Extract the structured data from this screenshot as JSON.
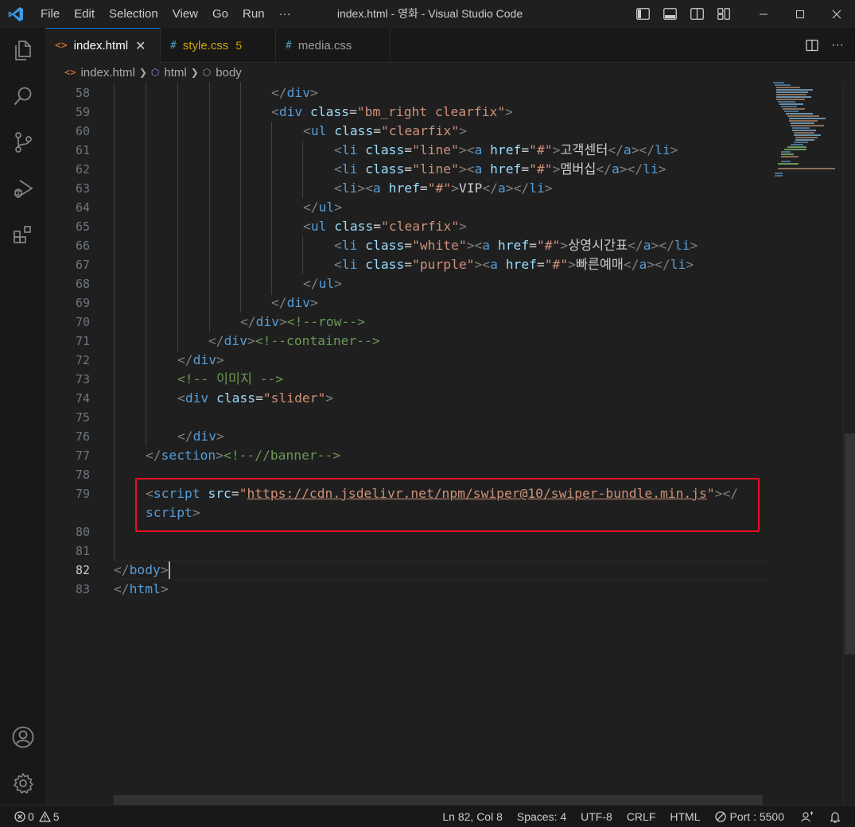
{
  "titlebar": {
    "menu": [
      "File",
      "Edit",
      "Selection",
      "View",
      "Go",
      "Run",
      "···"
    ],
    "window_title": "index.html - 영화 - Visual Studio Code"
  },
  "tabs": [
    {
      "label": "index.html",
      "icon": "html-file-icon",
      "active": true
    },
    {
      "label": "style.css",
      "icon": "css-file-icon",
      "badge": "5",
      "active": false,
      "color": "#cca700"
    },
    {
      "label": "media.css",
      "icon": "css-file-icon",
      "active": false
    }
  ],
  "breadcrumb": {
    "file": "index.html",
    "items": [
      "html",
      "body"
    ]
  },
  "editor": {
    "line_numbers": [
      "58",
      "59",
      "60",
      "61",
      "62",
      "63",
      "64",
      "65",
      "66",
      "67",
      "68",
      "69",
      "70",
      "71",
      "72",
      "73",
      "74",
      "75",
      "76",
      "77",
      "78",
      "79",
      "",
      "80",
      "81",
      "82",
      "83"
    ],
    "active_line": "82",
    "lines": {
      "l58": "</div>",
      "l59": "<div class=\"bm_right clearfix\">",
      "l60": "<ul class=\"clearfix\">",
      "l61_text": "고객센터",
      "l62_text": "멤버십",
      "l63_text": "VIP",
      "l66_text": "상영시간표",
      "l67_text": "빠른예매",
      "l70_comment": "<!--row-->",
      "l71_comment": "<!--container-->",
      "l73_comment": "<!-- 이미지 -->",
      "l77_comment": "<!--//banner-->",
      "l79_url": "https://cdn.jsdelivr.net/npm/swiper@10/swiper-bundle.min.js"
    }
  },
  "statusbar": {
    "errors": "0",
    "warnings": "5",
    "position": "Ln 82, Col 8",
    "spaces": "Spaces: 4",
    "encoding": "UTF-8",
    "eol": "CRLF",
    "language": "HTML",
    "port": "Port : 5500"
  },
  "colors": {
    "accent": "#0078d4",
    "highlight_box": "#e81123",
    "tag": "#569cd6",
    "attr": "#9cdcfe",
    "string": "#ce9178",
    "comment": "#6a9955"
  }
}
